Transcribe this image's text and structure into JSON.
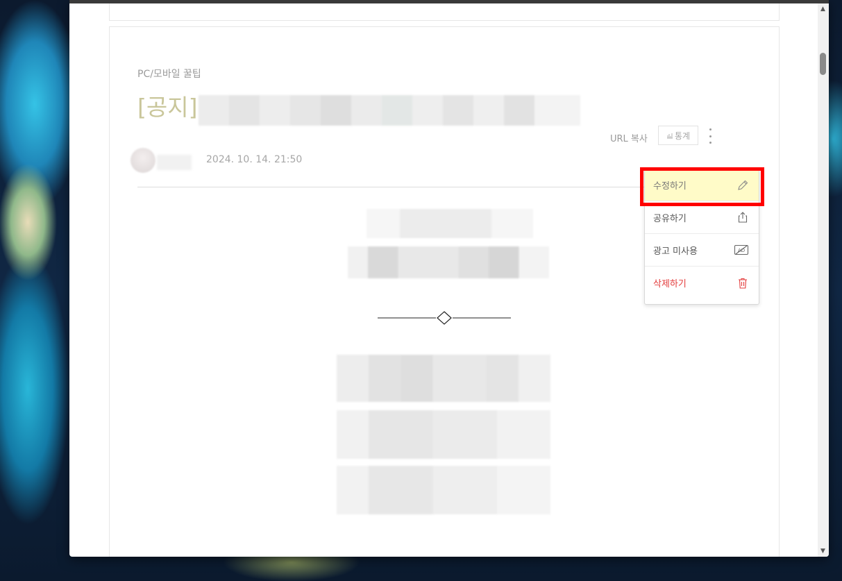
{
  "post": {
    "category": "PC/모바일 꿀팁",
    "title_prefix": "[공지]",
    "date": "2024. 10. 14. 21:50"
  },
  "toolbar": {
    "url_copy": "URL 복사",
    "stats": "통계"
  },
  "menu": {
    "items": [
      {
        "label": "수정하기",
        "icon": "pencil-icon"
      },
      {
        "label": "공유하기",
        "icon": "share-icon"
      },
      {
        "label": "광고 미사용",
        "icon": "ad-off-icon"
      },
      {
        "label": "삭제하기",
        "icon": "trash-icon"
      }
    ]
  },
  "colors": {
    "title": "#c9c69a",
    "highlight": "#fffbc8",
    "annotation": "#ff0000",
    "delete": "#e33b3b"
  }
}
